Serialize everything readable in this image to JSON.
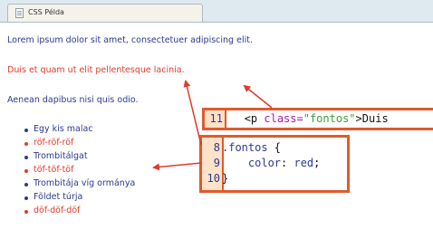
{
  "browser": {
    "tab_title": "CSS Példa"
  },
  "page": {
    "paragraph_1": "Lorem ipsum dolor sit amet, consectetuer adipiscing elit.",
    "paragraph_2": "Duis et quam ut elit pellentesque lacinia.",
    "paragraph_3": "Aenean dapibus nisi quis odio.",
    "list_items": [
      {
        "text": "Egy kis malac",
        "color": "#2b3a8f"
      },
      {
        "text": "röf-röf-röf",
        "color": "#e03a2a"
      },
      {
        "text": "Trombitálgat",
        "color": "#2b3a8f"
      },
      {
        "text": "töf-töf-töf",
        "color": "#e03a2a"
      },
      {
        "text": "Trombitája víg ormánya",
        "color": "#2b3a8f"
      },
      {
        "text": "Földet túrja",
        "color": "#2b3a8f"
      },
      {
        "text": "döf-döf-döf",
        "color": "#e03a2a"
      }
    ]
  },
  "code_html": {
    "line_number": "11",
    "indent": "   ",
    "tag_open": "<p ",
    "attr": "class=",
    "attr_value": "\"fontos\"",
    "tag_close": ">",
    "text": "Duis"
  },
  "code_css": {
    "lines": [
      {
        "num": "8",
        "selector": ".fontos",
        "rest": " {"
      },
      {
        "num": "9",
        "property": "    color",
        "colon": ": ",
        "value": "red",
        "end": ";"
      },
      {
        "num": "10",
        "close": "}"
      }
    ]
  },
  "colors": {
    "accent": "#e05a2c",
    "text_blue": "#2b3a8f",
    "text_red": "#e03a2a",
    "gutter_bg": "#ffe2c9"
  }
}
